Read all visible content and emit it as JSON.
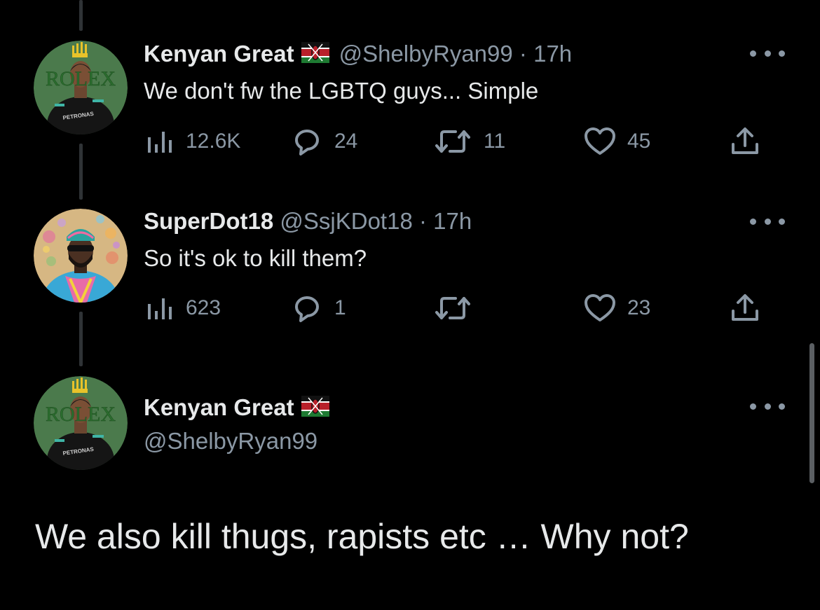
{
  "tweets": [
    {
      "name": "Kenyan Great",
      "handle": "@ShelbyRyan99",
      "separator": "·",
      "time": "17h",
      "text": "We don't fw the LGBTQ guys... Simple",
      "views": "12.6K",
      "replies": "24",
      "retweets": "11",
      "likes": "45"
    },
    {
      "name": "SuperDot18",
      "handle": "@SsjKDot18",
      "separator": "·",
      "time": "17h",
      "text": "So it's ok to kill them?",
      "views": "623",
      "replies": "1",
      "retweets": "",
      "likes": "23"
    }
  ],
  "focused": {
    "name": "Kenyan Great",
    "handle": "@ShelbyRyan99",
    "text": "We also kill thugs, rapists etc … Why not?"
  },
  "avatar_kenyan": {
    "logo_text": "ROLEX",
    "shirt_text": "PETRONAS"
  },
  "icons": {
    "views": "views-icon",
    "reply": "reply-icon",
    "retweet": "retweet-icon",
    "like": "like-icon",
    "share": "share-icon",
    "more": "more-icon",
    "flag": "kenya-flag-icon"
  },
  "colors": {
    "background": "#000000",
    "text": "#e7e9ea",
    "muted": "#8b98a5",
    "avatar_green": "#4b7a4c"
  }
}
